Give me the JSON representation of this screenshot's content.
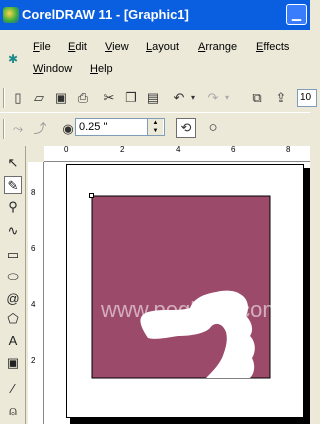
{
  "window": {
    "title": "CorelDRAW 11 - [Graphic1]",
    "buttons": [
      {
        "name": "minimize-button",
        "glyph": "▁"
      }
    ]
  },
  "menubar": {
    "items": [
      {
        "label": "File"
      },
      {
        "label": "Edit"
      },
      {
        "label": "View"
      },
      {
        "label": "Layout"
      },
      {
        "label": "Arrange"
      },
      {
        "label": "Effects"
      },
      {
        "label": "Window"
      },
      {
        "label": "Help"
      }
    ]
  },
  "standard_toolbar": {
    "zoom_partial": "10"
  },
  "property_bar": {
    "outline_width": "0.25 \""
  },
  "rulers": {
    "horizontal_labels": [
      "0",
      "2",
      "4",
      "6",
      "8"
    ],
    "vertical_labels": [
      "8",
      "6",
      "4",
      "2"
    ]
  },
  "canvas": {
    "rect_color": "#9c4a6a",
    "watermark": "www.pegham.com"
  }
}
